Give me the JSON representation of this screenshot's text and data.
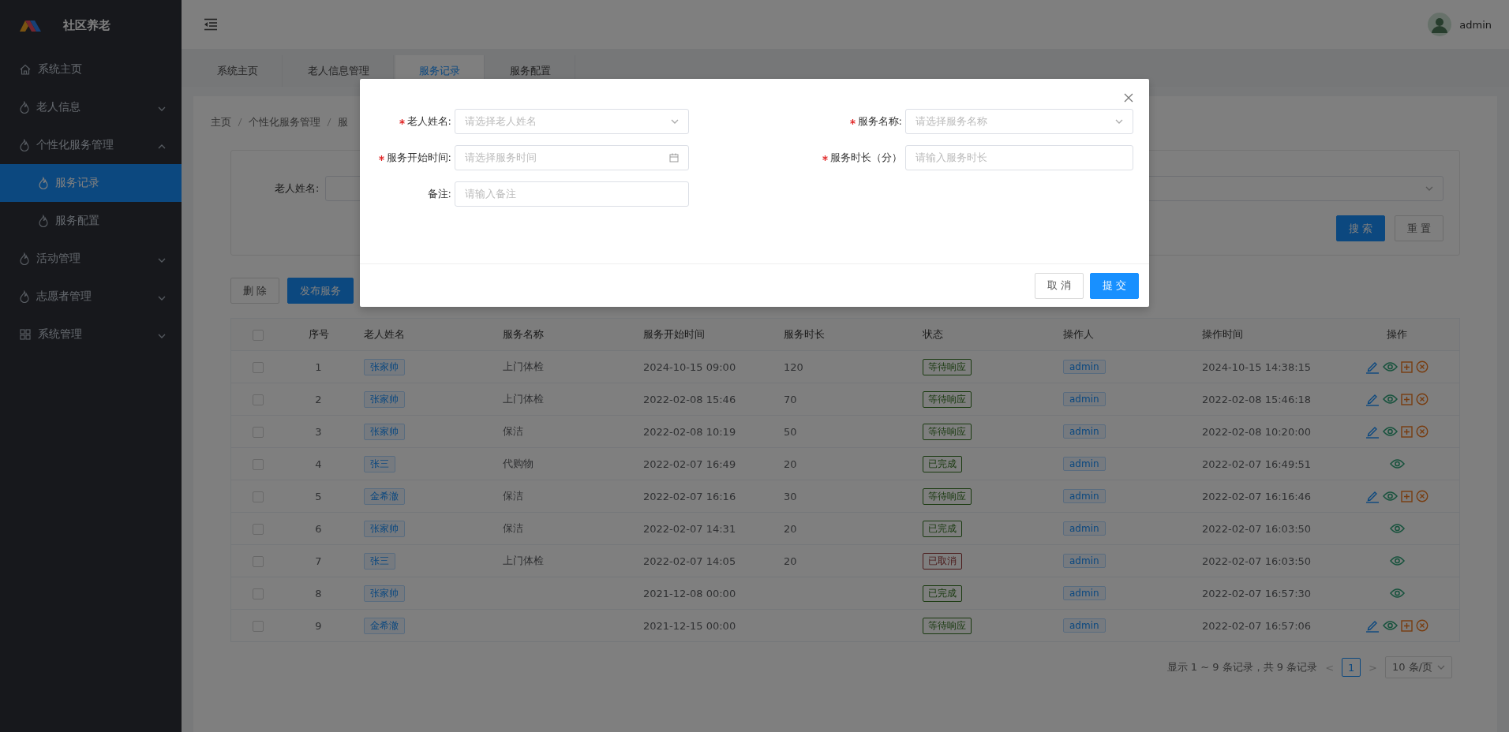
{
  "sidebar": {
    "logo": "社区养老",
    "items": [
      {
        "label": "系统主页",
        "kind": "home",
        "selected": false
      },
      {
        "label": "老人信息",
        "kind": "flame",
        "expanded": false,
        "selected": false
      },
      {
        "label": "个性化服务管理",
        "kind": "flame",
        "expanded": true,
        "selected": false,
        "children": [
          {
            "label": "服务记录",
            "selected": true
          },
          {
            "label": "服务配置",
            "selected": false
          }
        ]
      },
      {
        "label": "活动管理",
        "kind": "flame",
        "expanded": false,
        "selected": false
      },
      {
        "label": "志愿者管理",
        "kind": "flame",
        "expanded": false,
        "selected": false
      },
      {
        "label": "系统管理",
        "kind": "grid",
        "expanded": false,
        "selected": false
      }
    ]
  },
  "header": {
    "user": "admin"
  },
  "tabs": [
    {
      "label": "系统主页",
      "selected": false
    },
    {
      "label": "老人信息管理",
      "selected": false
    },
    {
      "label": "服务记录",
      "selected": true
    },
    {
      "label": "服务配置",
      "selected": false
    }
  ],
  "breadcrumb": [
    "主页",
    "个性化服务管理",
    "服"
  ],
  "search": {
    "label": "老人姓名:",
    "buttons": [
      {
        "label": "搜 索",
        "kind": "primary"
      },
      {
        "label": "重 置",
        "kind": "default"
      }
    ]
  },
  "toolbar": [
    {
      "label": "删 除",
      "kind": "default"
    },
    {
      "label": "发布服务",
      "kind": "primary"
    }
  ],
  "table": {
    "all_checked": false,
    "columns": [
      "序号",
      "老人姓名",
      "服务名称",
      "服务开始时间",
      "服务时长",
      "状态",
      "操作人",
      "操作时间",
      "操作"
    ],
    "rows": [
      {
        "checked": false,
        "no": "1",
        "name": "张家帅",
        "service": "上门体检",
        "start": "2024-10-15 09:00",
        "duration": "120",
        "status": {
          "text": "等待响应",
          "color": "#1a3a10"
        },
        "operator": "admin",
        "time": "2024-10-15 14:38:15",
        "actions": [
          {
            "kind": "edit"
          },
          {
            "kind": "view"
          },
          {
            "kind": "add"
          },
          {
            "kind": "cancel"
          }
        ]
      },
      {
        "checked": false,
        "no": "2",
        "name": "张家帅",
        "service": "上门体检",
        "start": "2022-02-08 15:46",
        "duration": "70",
        "status": {
          "text": "等待响应",
          "color": "#1a3a10"
        },
        "operator": "admin",
        "time": "2022-02-08 15:46:18",
        "actions": [
          {
            "kind": "edit"
          },
          {
            "kind": "view"
          },
          {
            "kind": "add"
          },
          {
            "kind": "cancel"
          }
        ]
      },
      {
        "checked": false,
        "no": "3",
        "name": "张家帅",
        "service": "保洁",
        "start": "2022-02-08 10:19",
        "duration": "50",
        "status": {
          "text": "等待响应",
          "color": "#1a3a10"
        },
        "operator": "admin",
        "time": "2022-02-08 10:20:00",
        "actions": [
          {
            "kind": "edit"
          },
          {
            "kind": "view"
          },
          {
            "kind": "add"
          },
          {
            "kind": "cancel"
          }
        ]
      },
      {
        "checked": false,
        "no": "4",
        "name": "张三",
        "service": "代购物",
        "start": "2022-02-07 16:49",
        "duration": "20",
        "status": {
          "text": "已完成",
          "color": "#1a3a10"
        },
        "operator": "admin",
        "time": "2022-02-07 16:49:51",
        "actions": [
          {
            "kind": "view"
          }
        ]
      },
      {
        "checked": false,
        "no": "5",
        "name": "金希澈",
        "service": "保洁",
        "start": "2022-02-07 16:16",
        "duration": "30",
        "status": {
          "text": "等待响应",
          "color": "#1a3a10"
        },
        "operator": "admin",
        "time": "2022-02-07 16:16:46",
        "actions": [
          {
            "kind": "edit"
          },
          {
            "kind": "view"
          },
          {
            "kind": "add"
          },
          {
            "kind": "cancel"
          }
        ]
      },
      {
        "checked": false,
        "no": "6",
        "name": "张家帅",
        "service": "保洁",
        "start": "2022-02-07 14:31",
        "duration": "20",
        "status": {
          "text": "已完成",
          "color": "#1a3a10"
        },
        "operator": "admin",
        "time": "2022-02-07 16:03:50",
        "actions": [
          {
            "kind": "view"
          }
        ]
      },
      {
        "checked": false,
        "no": "7",
        "name": "张三",
        "service": "上门体检",
        "start": "2022-02-07 14:05",
        "duration": "20",
        "status": {
          "text": "已取消",
          "color": "#4a1a1a"
        },
        "operator": "admin",
        "time": "2022-02-07 16:03:50",
        "actions": [
          {
            "kind": "view"
          }
        ]
      },
      {
        "checked": false,
        "no": "8",
        "name": "张家帅",
        "start": "2021-12-08 00:00",
        "status": {
          "text": "已完成",
          "color": "#1a3a10"
        },
        "operator": "admin",
        "time": "2022-02-07 16:57:30",
        "actions": [
          {
            "kind": "view"
          }
        ]
      },
      {
        "checked": false,
        "no": "9",
        "name": "金希澈",
        "start": "2021-12-15 00:00",
        "status": {
          "text": "等待响应",
          "color": "#1a3a10"
        },
        "operator": "admin",
        "time": "2022-02-07 16:57:06",
        "actions": [
          {
            "kind": "edit"
          },
          {
            "kind": "view"
          },
          {
            "kind": "add"
          },
          {
            "kind": "cancel"
          }
        ]
      }
    ]
  },
  "pagination": {
    "summary": "显示 1 ~ 9 条记录，共 9 条记录",
    "prev": "<",
    "pages": [
      {
        "label": "1",
        "selected": true
      }
    ],
    "next": ">",
    "page_size": "10 条/页"
  },
  "dialog": {
    "fields": [
      {
        "label": "老人姓名:",
        "required": true,
        "kind": "select",
        "placeholder": "请选择老人姓名"
      },
      {
        "label": "服务名称:",
        "required": true,
        "kind": "select",
        "placeholder": "请选择服务名称"
      },
      {
        "label": "服务开始时间:",
        "required": true,
        "kind": "date",
        "placeholder": "请选择服务时间"
      },
      {
        "label": "服务时长（分）",
        "required": true,
        "kind": "text",
        "placeholder": "请输入服务时长"
      },
      {
        "label": "备注:",
        "required": false,
        "kind": "text",
        "placeholder": "请输入备注"
      }
    ],
    "buttons": [
      {
        "label": "取 消",
        "kind": "default"
      },
      {
        "label": "提 交",
        "kind": "primary"
      }
    ]
  }
}
